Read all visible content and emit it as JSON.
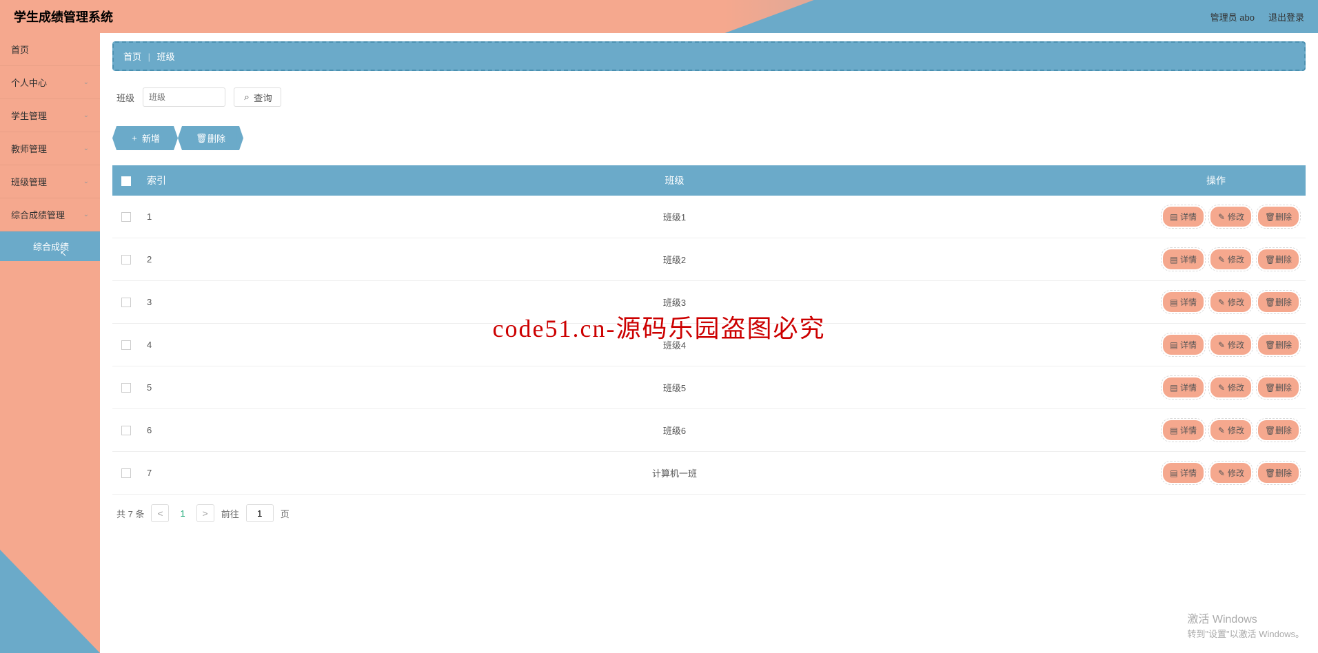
{
  "header": {
    "title": "学生成绩管理系统",
    "user_label": "管理员 abo",
    "logout_label": "退出登录"
  },
  "sidebar": {
    "items": [
      {
        "label": "首页",
        "expandable": false
      },
      {
        "label": "个人中心",
        "expandable": true
      },
      {
        "label": "学生管理",
        "expandable": true
      },
      {
        "label": "教师管理",
        "expandable": true
      },
      {
        "label": "班级管理",
        "expandable": true
      },
      {
        "label": "综合成绩管理",
        "expandable": true
      }
    ],
    "sub_active": "综合成绩"
  },
  "breadcrumb": {
    "home": "首页",
    "current": "班级"
  },
  "search": {
    "label": "班级",
    "placeholder": "班级",
    "button": "查询"
  },
  "toolbar": {
    "add": "新增",
    "delete": "删除"
  },
  "table": {
    "headers": {
      "index": "索引",
      "class": "班级",
      "ops": "操作"
    },
    "rows": [
      {
        "index": "1",
        "class": "班级1"
      },
      {
        "index": "2",
        "class": "班级2"
      },
      {
        "index": "3",
        "class": "班级3"
      },
      {
        "index": "4",
        "class": "班级4"
      },
      {
        "index": "5",
        "class": "班级5"
      },
      {
        "index": "6",
        "class": "班级6"
      },
      {
        "index": "7",
        "class": "计算机一班"
      }
    ],
    "actions": {
      "detail": "详情",
      "edit": "修改",
      "delete": "删除"
    }
  },
  "pagination": {
    "total": "共 7 条",
    "page": "1",
    "goto_prefix": "前往",
    "goto_value": "1",
    "goto_suffix": "页"
  },
  "watermark": "code51.cn-源码乐园盗图必究",
  "win": {
    "title": "激活 Windows",
    "sub": "转到\"设置\"以激活 Windows。"
  }
}
